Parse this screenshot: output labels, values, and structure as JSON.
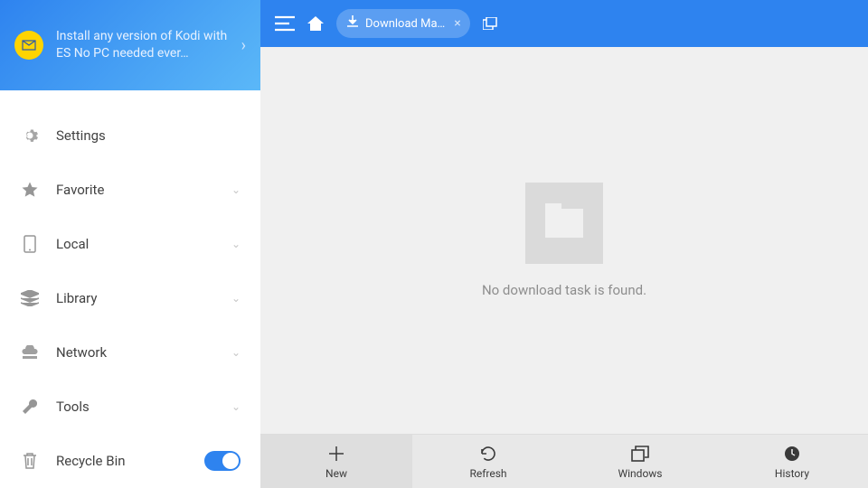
{
  "banner": {
    "text": "Install any version of Kodi with ES No PC needed ever…"
  },
  "sidebar": {
    "items": [
      {
        "label": "Settings",
        "icon": "gear",
        "expandable": false
      },
      {
        "label": "Favorite",
        "icon": "star",
        "expandable": true
      },
      {
        "label": "Local",
        "icon": "phone",
        "expandable": true
      },
      {
        "label": "Library",
        "icon": "stack",
        "expandable": true
      },
      {
        "label": "Network",
        "icon": "cloud",
        "expandable": true
      },
      {
        "label": "Tools",
        "icon": "wrench",
        "expandable": true
      },
      {
        "label": "Recycle Bin",
        "icon": "trash",
        "expandable": false,
        "toggle": true
      }
    ]
  },
  "topbar": {
    "tab": {
      "label": "Download Ma…"
    }
  },
  "empty": {
    "message": "No download task is found."
  },
  "bottombar": {
    "items": [
      {
        "label": "New"
      },
      {
        "label": "Refresh"
      },
      {
        "label": "Windows"
      },
      {
        "label": "History"
      }
    ]
  }
}
